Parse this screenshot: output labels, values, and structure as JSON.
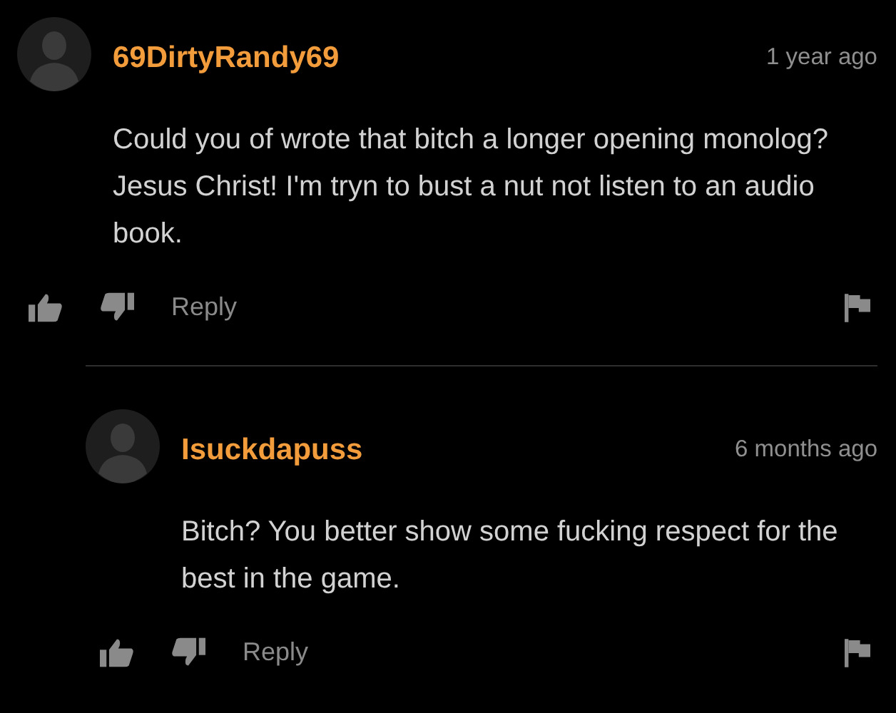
{
  "comments": [
    {
      "username": "69DirtyRandy69",
      "time": "1 year ago",
      "text": "Could you of wrote that bitch a longer opening monolog? Jesus Christ! I'm tryn to bust a nut not listen to an audio book.",
      "reply_label": "Reply",
      "replies": [
        {
          "username": "Isuckdapuss",
          "time": "6 months ago",
          "text": "Bitch? You better show some fucking respect for the best in the game.",
          "reply_label": "Reply"
        }
      ]
    }
  ]
}
